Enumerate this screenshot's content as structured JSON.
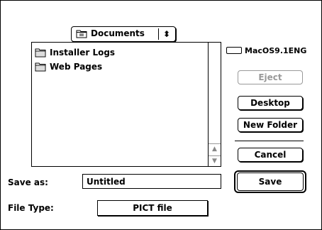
{
  "location_popup": {
    "label": "Documents",
    "arrows": "⬍",
    "icon": "documents-folder-icon"
  },
  "file_list": {
    "items": [
      {
        "label": "Installer Logs",
        "icon": "folder-icon"
      },
      {
        "label": "Web Pages",
        "icon": "folder-icon"
      }
    ],
    "scroll_up": "▲",
    "scroll_down": "▼"
  },
  "volume": {
    "label": "MacOS9.1ENG",
    "icon": "hard-disk-icon"
  },
  "buttons": {
    "eject": "Eject",
    "desktop": "Desktop",
    "new_folder": "New Folder",
    "cancel": "Cancel",
    "save": "Save"
  },
  "save_as": {
    "label": "Save as:",
    "value": "Untitled"
  },
  "file_type": {
    "label": "File Type:",
    "value": "PICT file"
  }
}
